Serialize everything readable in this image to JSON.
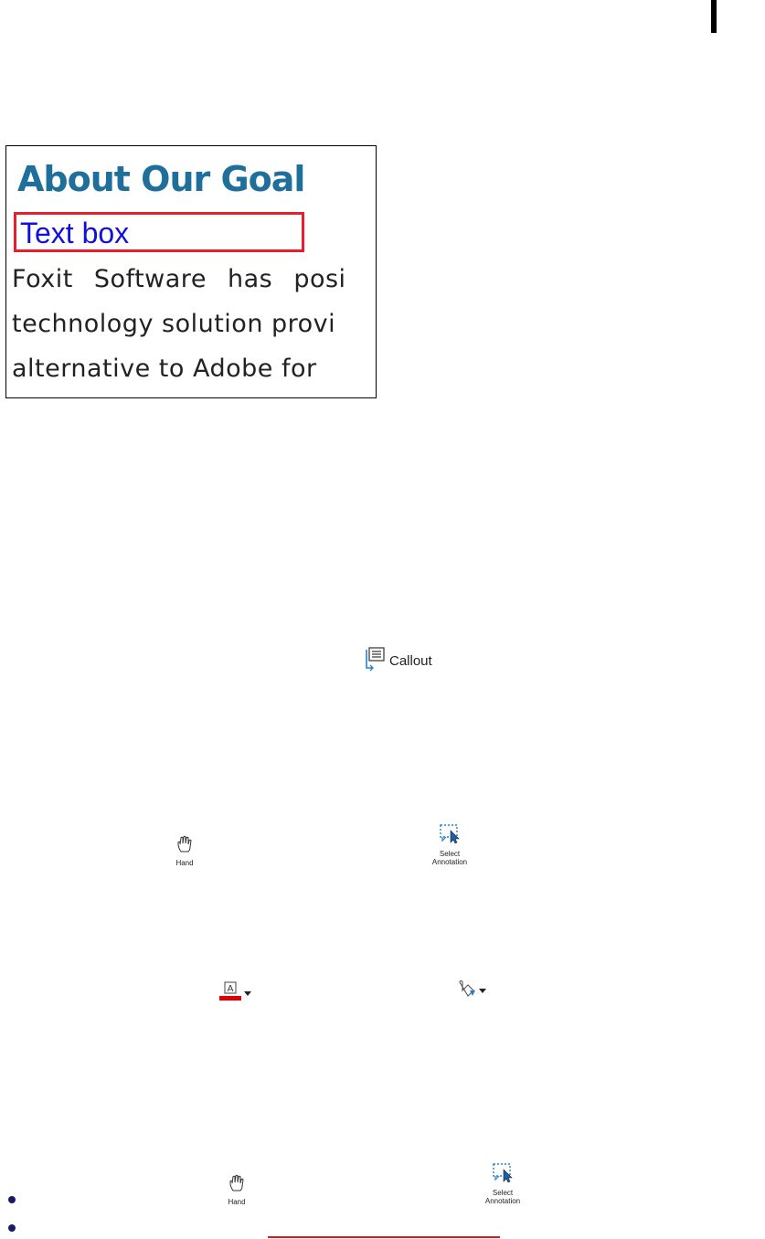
{
  "sample_image": {
    "title": "About Our Goal",
    "textbox_label": "Text box",
    "body_lines": [
      "Foxit Software has posi",
      "technology solution provi",
      "alternative to Adobe for"
    ]
  },
  "toolbar": {
    "callout_label": "Callout",
    "hand_label": "Hand",
    "select_annotation_label_1": "Select",
    "select_annotation_label_2": "Annotation"
  },
  "colors": {
    "title": "#1e6f9b",
    "textbox_border": "#e81e2a",
    "textbox_text": "#1010e0",
    "text_color_swatch": "#e00000",
    "bullet": "#1a1a66"
  }
}
